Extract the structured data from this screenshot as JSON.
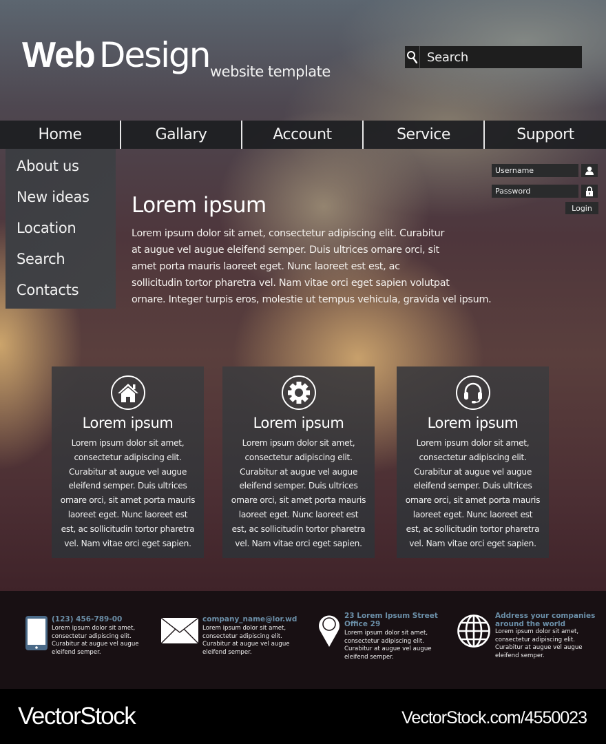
{
  "header": {
    "logo_bold": "Web",
    "logo_light": "Design",
    "logo_subtitle": "website template",
    "search": {
      "placeholder": "Search",
      "value": "",
      "icon": "search-icon"
    }
  },
  "nav": {
    "items": [
      {
        "label": "Home"
      },
      {
        "label": "Gallary"
      },
      {
        "label": "Account"
      },
      {
        "label": "Service"
      },
      {
        "label": "Support"
      }
    ]
  },
  "side_menu": {
    "items": [
      {
        "label": "About us"
      },
      {
        "label": "New ideas"
      },
      {
        "label": "Location"
      },
      {
        "label": "Search"
      },
      {
        "label": "Contacts"
      }
    ]
  },
  "login": {
    "username_placeholder": "Username",
    "password_placeholder": "Password",
    "username_icon": "user-icon",
    "password_icon": "lock-icon",
    "button_label": "Login"
  },
  "main": {
    "title": "Lorem ipsum",
    "body_lines": [
      "Lorem ipsum dolor sit amet, consectetur adipiscing elit. Curabitur",
      "at augue vel augue eleifend semper. Duis ultrices ornare orci, sit",
      "amet porta mauris laoreet eget. Nunc laoreet est est, ac",
      "sollicitudin tortor pharetra vel. Nam vitae orci eget sapien volutpat",
      "ornare. Integer turpis eros, molestie ut tempus vehicula, gravida vel ipsum."
    ]
  },
  "cards": [
    {
      "icon": "home-icon",
      "title": "Lorem ipsum",
      "body_lines": [
        "Lorem ipsum dolor sit amet,",
        "consectetur adipiscing elit.",
        "Curabitur at augue vel augue",
        "eleifend semper. Duis ultrices",
        "ornare orci, sit amet porta mauris",
        "laoreet eget. Nunc laoreet est",
        "est, ac sollicitudin tortor pharetra",
        "vel. Nam vitae orci eget sapien."
      ]
    },
    {
      "icon": "gear-icon",
      "title": "Lorem ipsum",
      "body_lines": [
        "Lorem ipsum dolor sit amet,",
        "consectetur adipiscing elit.",
        "Curabitur at augue vel augue",
        "eleifend semper. Duis ultrices",
        "ornare orci, sit amet porta mauris",
        "laoreet eget. Nunc laoreet est",
        "est, ac sollicitudin tortor pharetra",
        "vel. Nam vitae orci eget sapien."
      ]
    },
    {
      "icon": "headset-icon",
      "title": "Lorem ipsum",
      "body_lines": [
        "Lorem ipsum dolor sit amet,",
        "consectetur adipiscing elit.",
        "Curabitur at augue vel augue",
        "eleifend semper. Duis ultrices",
        "ornare orci, sit amet porta mauris",
        "laoreet eget. Nunc laoreet est",
        "est, ac sollicitudin tortor pharetra",
        "vel. Nam vitae orci eget sapien."
      ]
    }
  ],
  "footer": {
    "accent_color": "#6b8fa8",
    "items": [
      {
        "icon": "phone-icon",
        "title_lines": [
          "(123) 456-789-00"
        ],
        "body_lines": [
          "Lorem ipsum dolor sit amet,",
          "consectetur adipiscing elit.",
          "Curabitur at augue vel augue",
          "eleifend semper."
        ]
      },
      {
        "icon": "envelope-icon",
        "title_lines": [
          "company_name@lor.wd"
        ],
        "body_lines": [
          "Lorem ipsum dolor sit amet,",
          "consectetur adipiscing elit.",
          "Curabitur at augue vel augue",
          "eleifend semper."
        ]
      },
      {
        "icon": "map-pin-icon",
        "title_lines": [
          "23 Lorem Ipsum Street",
          "Office 29"
        ],
        "body_lines": [
          "Lorem ipsum dolor sit amet,",
          "consectetur adipiscing elit.",
          "Curabitur at augue vel augue",
          "eleifend semper."
        ]
      },
      {
        "icon": "globe-icon",
        "title_lines": [
          "Address your companies",
          "around the world"
        ],
        "body_lines": [
          "Lorem ipsum dolor sit amet,",
          "consectetur adipiscing elit.",
          "Curabitur at augue vel augue",
          "eleifend semper."
        ]
      }
    ]
  },
  "watermark": {
    "brand": "VectorStock",
    "url": "VectorStock.com/4550023"
  }
}
